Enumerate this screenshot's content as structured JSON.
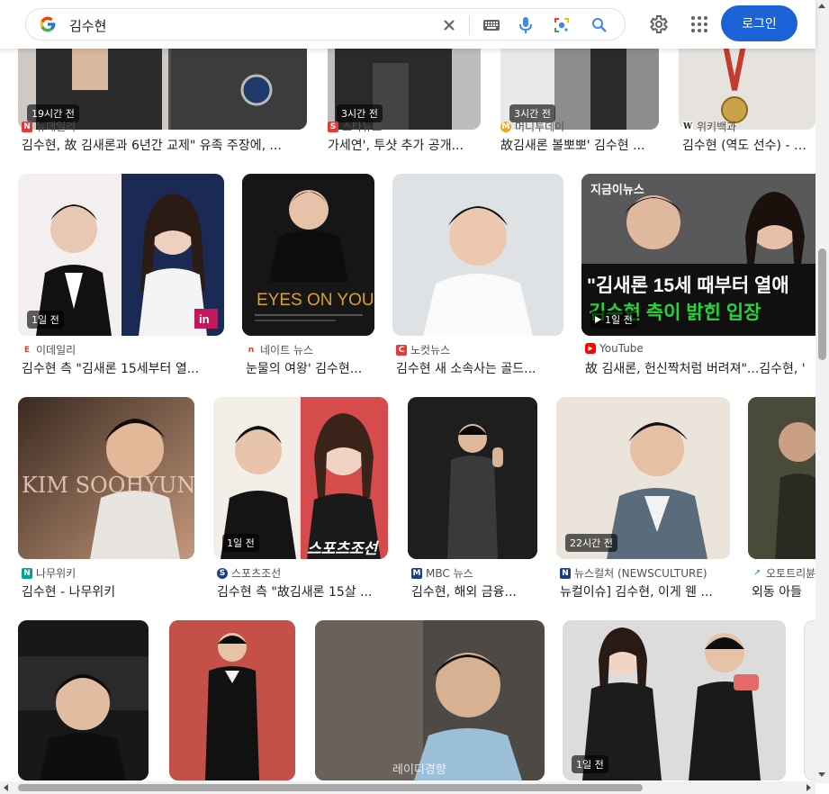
{
  "search": {
    "query": "김수현"
  },
  "header": {
    "login_label": "로그인"
  },
  "rows": [
    [
      {
        "badge": "19시간 전",
        "source": "뉴데일리",
        "title": "김수현, 故 김새론과 6년간 교제\" 유족 주장에, ...",
        "fav": "N",
        "fav_color": "#e53935",
        "thumb_colors": [
          "#cfc9c4",
          "#6a6a6a"
        ]
      },
      {
        "badge": "3시간 전",
        "source": "스타뉴스",
        "title": "가세연', 투샷 추가 공개...",
        "fav": "S",
        "fav_color": "#e53935",
        "thumb_colors": [
          "#b8b8b8",
          "#3a3a3a"
        ]
      },
      {
        "badge": "3시간 전",
        "source": "머니투데이",
        "title": "故김새론 볼뽀뽀' 김수현 ...",
        "fav": "M",
        "fav_color": "#f5a623",
        "thumb_colors": [
          "#9c9c9c",
          "#d8d8d8"
        ]
      },
      {
        "badge": "",
        "source": "위키백과",
        "title": "김수현 (역도 선수) - 위...",
        "fav": "W",
        "fav_color": "#ffffff",
        "thumb_colors": [
          "#e8e6e4",
          "#c9a24a"
        ]
      }
    ],
    [
      {
        "badge": "1일 전",
        "source": "이데일리",
        "title": "김수현 측 \"김새론 15세부터 열...",
        "fav": "E",
        "fav_color": "#e53935",
        "thumb_colors": [
          "#f4f2f1",
          "#2a2a2a"
        ]
      },
      {
        "badge": "",
        "source": "네이트 뉴스",
        "title": "눈물의 여왕' 김수현...",
        "fav": "n",
        "fav_color": "#e53935",
        "thumb_colors": [
          "#1e1e1e",
          "#d9a02a"
        ]
      },
      {
        "badge": "",
        "source": "노컷뉴스",
        "title": "김수현 새 소속사는 골드...",
        "fav": "C",
        "fav_color": "#e53935",
        "thumb_colors": [
          "#dfe3e6",
          "#f5f5f5"
        ]
      },
      {
        "badge": "1일 전",
        "source": "YouTube",
        "title": "故 김새론, 헌신짝처럼 버려져\"...김수현, '",
        "fav": "▶",
        "fav_color": "#ff0000",
        "thumb_colors": [
          "#3b3b3b",
          "#111111"
        ]
      }
    ],
    [
      {
        "badge": "",
        "source": "나무위키",
        "title": "김수현 - 나무위키",
        "fav": "N",
        "fav_color": "#00a495",
        "thumb_colors": [
          "#6b4a36",
          "#2a1f1a"
        ]
      },
      {
        "badge": "1일 전",
        "source": "스포츠조선",
        "title": "김수현 측 \"故김새론 15살 ...",
        "fav": "S",
        "fav_color": "#1a3d8f",
        "thumb_colors": [
          "#f2ebe4",
          "#1b1b1b"
        ]
      },
      {
        "badge": "",
        "source": "MBC 뉴스",
        "title": "김수현, 해외 금융...",
        "fav": "M",
        "fav_color": "#1a3d8f",
        "thumb_colors": [
          "#202020",
          "#3d3d3d"
        ]
      },
      {
        "badge": "22시간 전",
        "source": "뉴스컬처 (NEWSCULTURE)",
        "title": "뉴컬이슈] 김수현, 이게 웬 ...",
        "fav": "N",
        "fav_color": "#1a3d8f",
        "thumb_colors": [
          "#e9e2d8",
          "#5c7080"
        ]
      },
      {
        "badge": "",
        "source": "오토트리뷴",
        "title": "외동 아들 ",
        "fav": "↗",
        "fav_color": "#1aa3e8",
        "thumb_colors": [
          "#3a3a2a",
          "#6b6a4a"
        ]
      }
    ],
    [
      {
        "badge": "",
        "source": "",
        "title": "",
        "fav": "",
        "fav_color": "#ffffff",
        "thumb_colors": [
          "#1a1a1a",
          "#3a3a3a"
        ]
      },
      {
        "badge": "",
        "source": "",
        "title": "",
        "fav": "",
        "fav_color": "#ffffff",
        "thumb_colors": [
          "#c84a4a",
          "#111111"
        ]
      },
      {
        "badge": "",
        "source": "",
        "title": "",
        "fav": "",
        "fav_color": "#ffffff",
        "thumb_colors": [
          "#4a4844",
          "#a89888"
        ]
      },
      {
        "badge": "1일 전",
        "source": "",
        "title": "",
        "fav": "",
        "fav_color": "#ffffff",
        "thumb_colors": [
          "#d8d8d8",
          "#2a2a2a"
        ]
      },
      {
        "badge": "",
        "source": "",
        "title": "",
        "fav": "",
        "fav_color": "#ffffff",
        "thumb_colors": [
          "#eeeeee",
          "#cccccc"
        ]
      }
    ]
  ],
  "watermarks": {
    "eyes_you": "EYES ON YOU",
    "kim_soohyun": "KIM SOOHYUN",
    "youtube_caption": "\"김새론 15세 때부터 열애",
    "youtube_caption2": "김수현 측이 밝힌 입장",
    "youtube_channel": "지금이뉴스",
    "sports_logo": "스포츠조선",
    "ready_logo": "레이디경향"
  }
}
